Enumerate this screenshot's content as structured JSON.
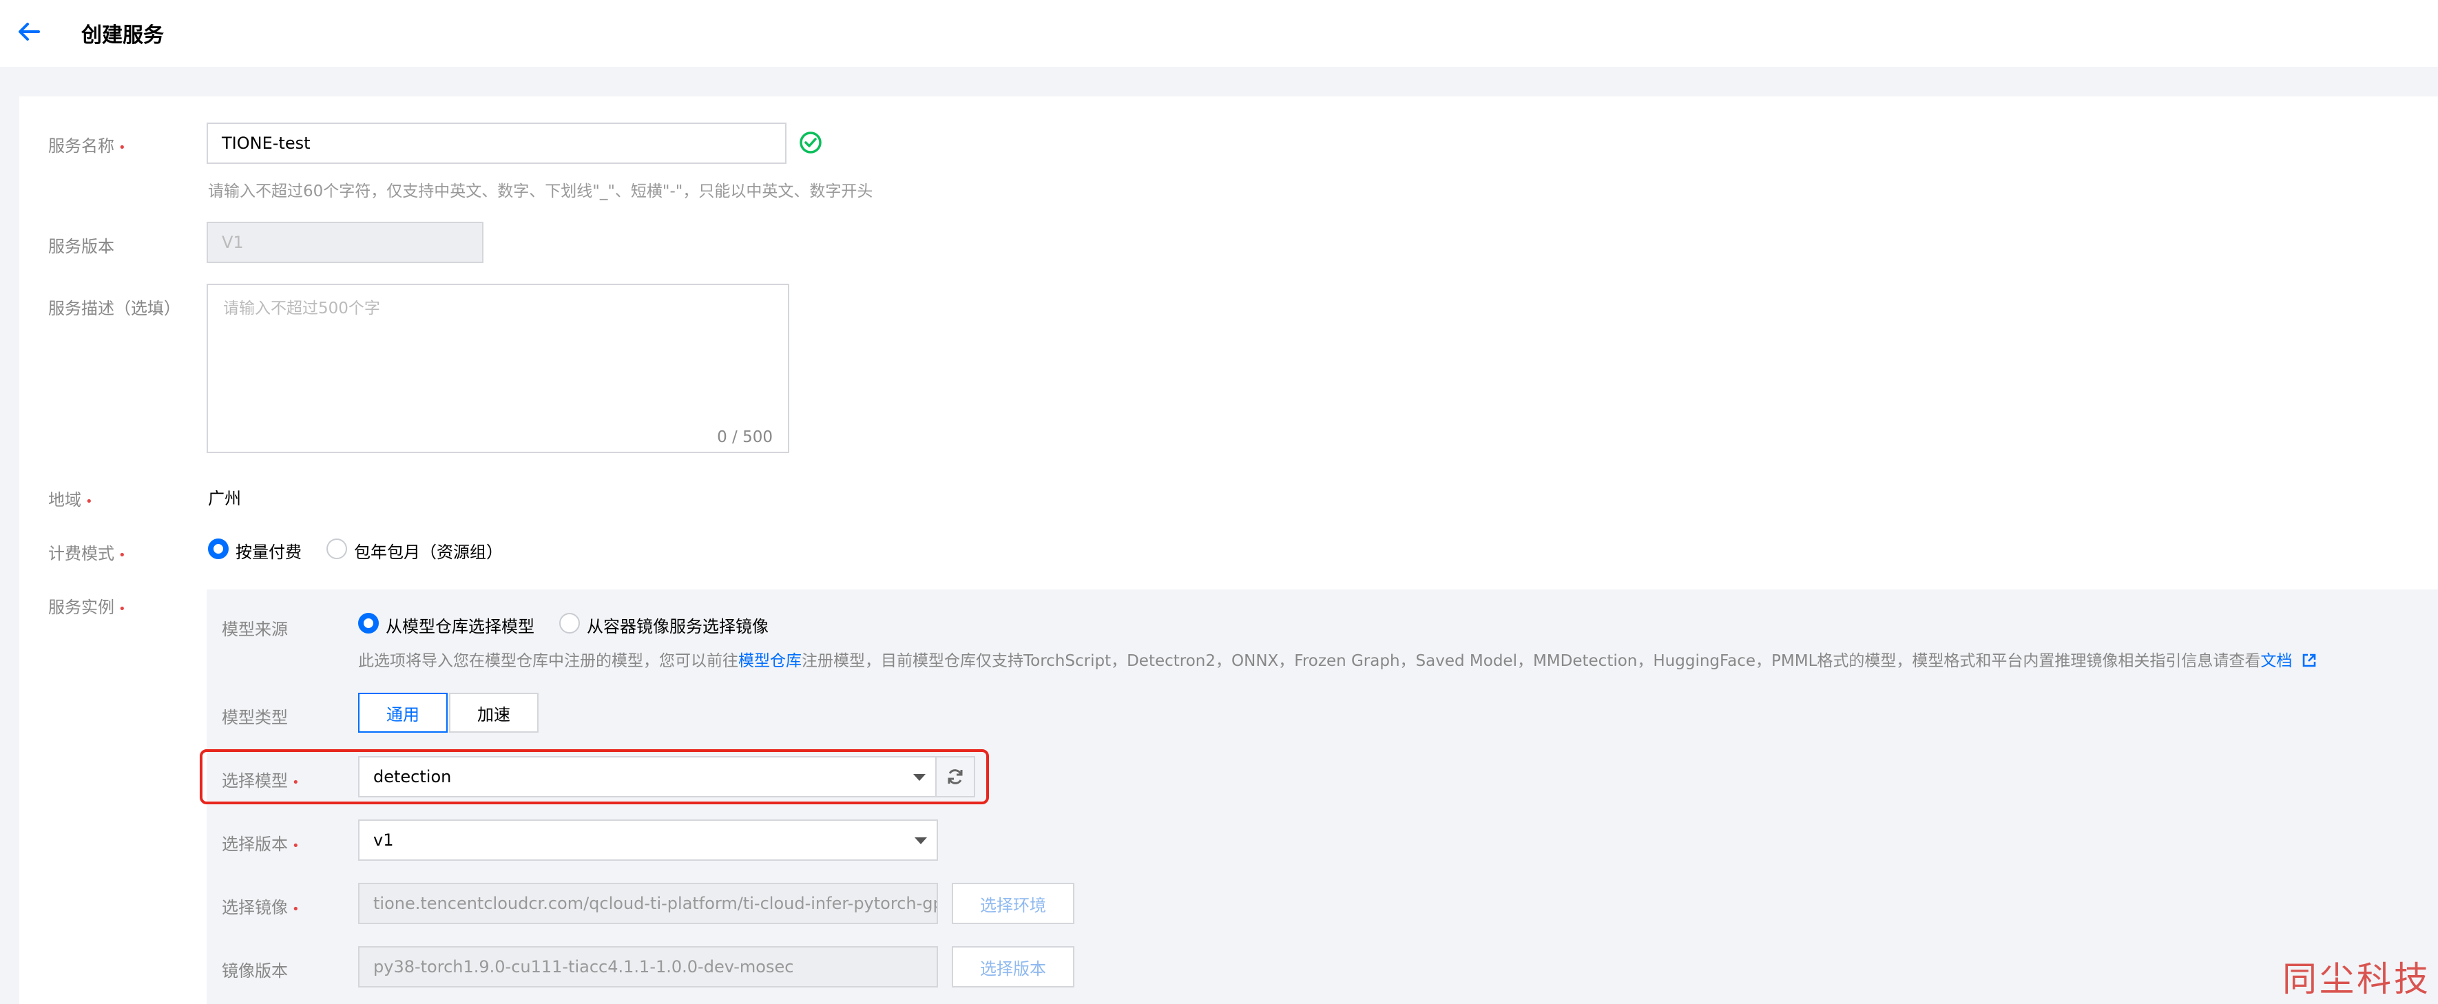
{
  "header": {
    "title": "创建服务"
  },
  "form": {
    "service_name": {
      "label": "服务名称",
      "value": "TIONE-test",
      "hint": "请输入不超过60个字符，仅支持中英文、数字、下划线\"_\"、短横\"-\"，只能以中英文、数字开头"
    },
    "service_version": {
      "label": "服务版本",
      "value": "V1"
    },
    "service_desc": {
      "label": "服务描述（选填）",
      "placeholder": "请输入不超过500个字",
      "counter": "0 / 500"
    },
    "region": {
      "label": "地域",
      "value": "广州"
    },
    "billing": {
      "label": "计费模式",
      "options": [
        "按量付费",
        "包年包月（资源组）"
      ],
      "selected": "按量付费"
    },
    "instance": {
      "label": "服务实例"
    }
  },
  "instance": {
    "model_source": {
      "label": "模型来源",
      "options": [
        "从模型仓库选择模型",
        "从容器镜像服务选择镜像"
      ],
      "selected": "从模型仓库选择模型",
      "desc_prefix": "此选项将导入您在模型仓库中注册的模型，您可以前往",
      "desc_link": "模型仓库",
      "desc_suffix": "注册模型，目前模型仓库仅支持TorchScript，Detectron2，ONNX，Frozen Graph，Saved Model，MMDetection，HuggingFace，PMML格式的模型，模型格式和平台内置推理镜像相关指引信息请查看",
      "doc_link": "文档"
    },
    "model_type": {
      "label": "模型类型",
      "options": [
        "通用",
        "加速"
      ],
      "selected": "通用"
    },
    "select_model": {
      "label": "选择模型",
      "value": "detection"
    },
    "select_version": {
      "label": "选择版本",
      "value": "v1"
    },
    "select_image": {
      "label": "选择镜像",
      "value": "tione.tencentcloudcr.com/qcloud-ti-platform/ti-cloud-infer-pytorch-gpu:py",
      "button": "选择环境"
    },
    "image_version": {
      "label": "镜像版本",
      "value": "py38-torch1.9.0-cu111-tiacc4.1.1-1.0.0-dev-mosec",
      "button": "选择版本"
    }
  },
  "watermark": "同尘科技",
  "colors": {
    "accent": "#006eff",
    "required": "#e54545",
    "highlight": "#e8261e",
    "success": "#0abf5b"
  }
}
